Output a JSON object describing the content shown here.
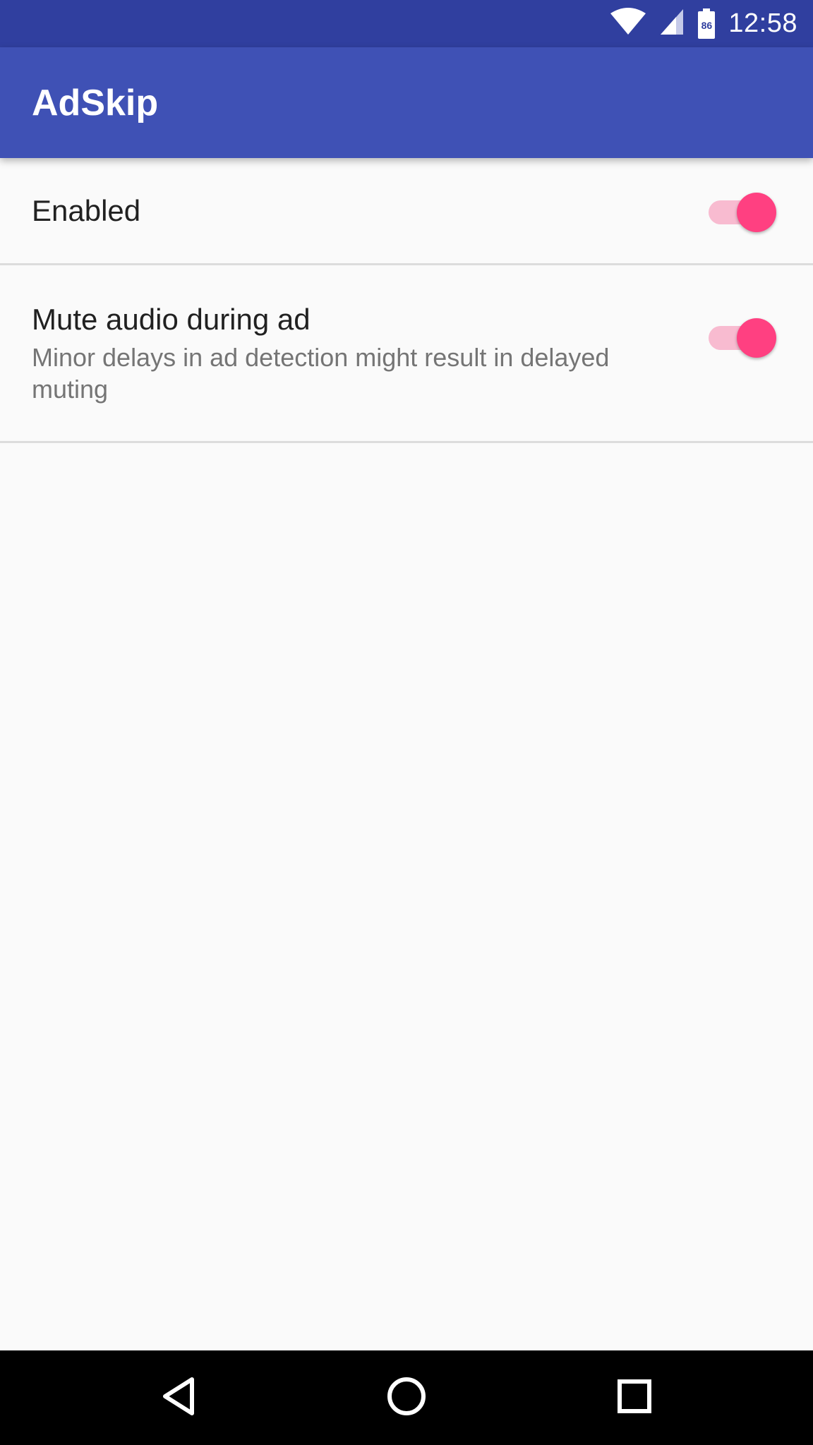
{
  "status_bar": {
    "time": "12:58",
    "battery_level": "86",
    "icons": [
      "wifi-icon",
      "cell-signal-icon",
      "battery-icon"
    ]
  },
  "app_bar": {
    "title": "AdSkip"
  },
  "preferences": [
    {
      "title": "Enabled",
      "summary": "",
      "checked": true
    },
    {
      "title": "Mute audio during ad",
      "summary": "Minor delays in ad detection might result in delayed muting",
      "checked": true
    }
  ],
  "nav_bar": {
    "icons": [
      "back-icon",
      "home-icon",
      "recents-icon"
    ]
  },
  "colors": {
    "status_bar": "#303f9f",
    "primary": "#3f51b5",
    "accent": "#ff4081",
    "switch_track": "#f8bbd0",
    "background": "#fafafa"
  }
}
